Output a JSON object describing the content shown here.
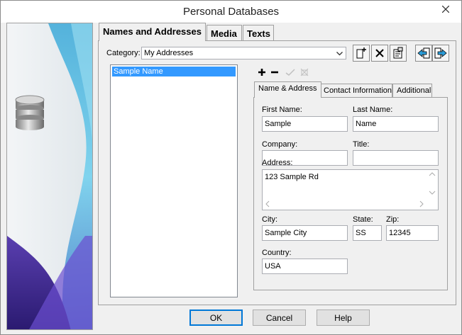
{
  "window": {
    "title": "Personal Databases"
  },
  "tabs": [
    {
      "label": "Names and Addresses"
    },
    {
      "label": "Media"
    },
    {
      "label": "Texts"
    }
  ],
  "category": {
    "label": "Category:",
    "value": "My Addresses"
  },
  "names_list": {
    "items": [
      "Sample Name"
    ]
  },
  "detail_tabs": [
    {
      "label": "Name & Address"
    },
    {
      "label": "Contact Information"
    },
    {
      "label": "Additional"
    }
  ],
  "form": {
    "first_name": {
      "label": "First Name:",
      "value": "Sample"
    },
    "last_name": {
      "label": "Last Name:",
      "value": "Name"
    },
    "company": {
      "label": "Company:",
      "value": ""
    },
    "title": {
      "label": "Title:",
      "value": ""
    },
    "address": {
      "label": "Address:",
      "value": "123 Sample Rd"
    },
    "city": {
      "label": "City:",
      "value": "Sample City"
    },
    "state": {
      "label": "State:",
      "value": "SS"
    },
    "zip": {
      "label": "Zip:",
      "value": "12345"
    },
    "country": {
      "label": "Country:",
      "value": "USA"
    }
  },
  "buttons": {
    "ok": "OK",
    "cancel": "Cancel",
    "help": "Help"
  },
  "icons": {
    "toolbar": [
      "new-category-icon",
      "delete-category-icon",
      "edit-category-icon",
      "import-icon",
      "export-icon"
    ],
    "list": [
      "add-icon",
      "remove-icon",
      "confirm-icon",
      "discard-icon"
    ],
    "sidebar": "database-icon"
  }
}
